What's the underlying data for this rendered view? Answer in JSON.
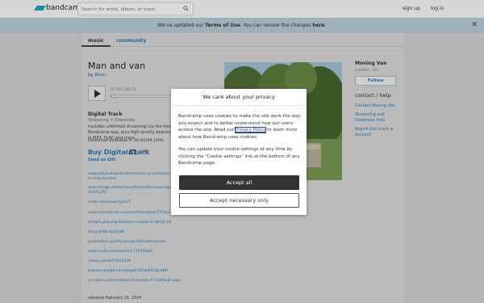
{
  "header": {
    "logo_text": "bandcamp",
    "search_placeholder": "Search for artist, album, or track",
    "signup": "sign up",
    "login": "log in"
  },
  "banner": {
    "prefix": "We've updated our ",
    "terms": "Terms of Use",
    "middle": ". You can review the changes ",
    "here": "here",
    "suffix": "."
  },
  "tabs": {
    "music": "music",
    "community": "community"
  },
  "track": {
    "title": "Man and van",
    "by_prefix": "by ",
    "artist": "Bean",
    "time": "00:00 / 00:21",
    "digital_title": "Digital Track",
    "digital_sub": "Streaming + Download",
    "desc": "Includes unlimited streaming via the free Bandcamp app, plus high-quality download in MP3, FLAC and more.",
    "availability": "Download available in 16-bit/44.1kHz.",
    "buy": "Buy Digital Track",
    "price": "£1",
    "currency": "GBP",
    "gift": "Send as Gift",
    "links": [
      "www.easymanandvanremovals.co.uk/removals-services/man-and-van-",
      "to-manchester/",
      "sourceforge.net/u/manwithvan/discussion/general/thread/",
      "dc5d12f0/",
      "trello.com/u/sandyla17",
      "www.liveinternet.ru/users/movingvan777/profile",
      "telegra.ph/Long-Distance-moves-in-UK-02-16",
      "chng.it/h6LhphjLQ8",
      "podcasters.spotify.com/pod/show/manvan",
      "www.imdb.com/user/ur177445662/",
      "vimeo.com/675422236",
      "express.adobe.com/page/c1X5bM1CByeKR",
      "cs.trains.com/members/easyman777/default.aspx"
    ],
    "released": "released February 16, 2024"
  },
  "artist": {
    "name": "Moving Van",
    "location": "London, UK",
    "follow": "Follow",
    "help_heading": "contact / help",
    "contact": "Contact Moving Van",
    "streaming_help": "Streaming and Download help",
    "report": "Report this track or account"
  },
  "cookie_modal": {
    "title": "We care about your privacy",
    "p1_before": "Bandcamp uses cookies to make the site work the way you expect and to better understand how our users access the site. Read our ",
    "p1_link": "Privacy Policy",
    "p1_after": " to learn more about how Bandcamp uses cookies.",
    "p2": "You can update your cookie settings at any time by clicking the \"Cookie settings\" link at the bottom of any Bandcamp page.",
    "accept_all": "Accept all",
    "accept_necessary": "Accept necessary only"
  },
  "colors": {
    "accent": "#1da0c3",
    "link": "#2a7ab8",
    "banner_bg": "#b9cfd7",
    "accept_bg": "#333333"
  }
}
